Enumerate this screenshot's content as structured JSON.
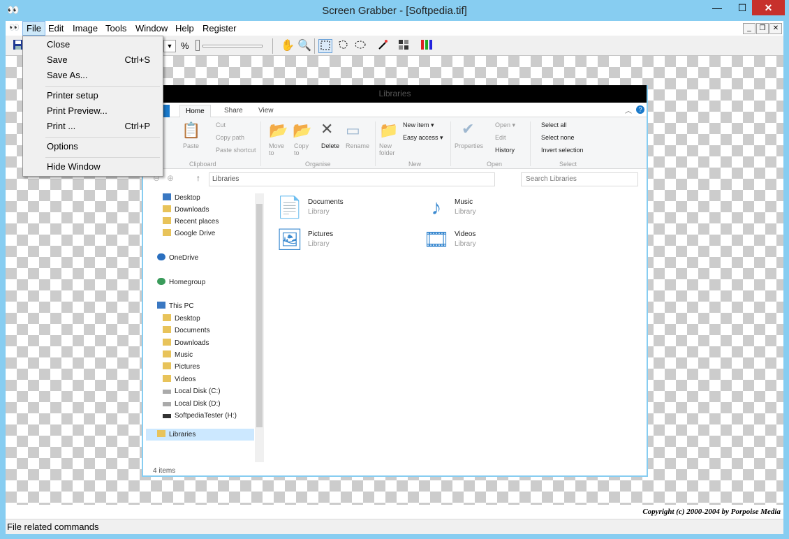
{
  "window": {
    "title": "Screen Grabber - [Softpedia.tif]",
    "minimize": "—",
    "maximize": "☐",
    "close": "✕"
  },
  "menubar": {
    "items": [
      {
        "label": "File"
      },
      {
        "label": "Edit"
      },
      {
        "label": "Image"
      },
      {
        "label": "Tools"
      },
      {
        "label": "Window"
      },
      {
        "label": "Help"
      },
      {
        "label": "Register"
      }
    ]
  },
  "toolbar": {
    "zoom_unit": "%"
  },
  "file_menu": {
    "items": [
      {
        "label": "Close",
        "shortcut": ""
      },
      {
        "label": "Save",
        "shortcut": "Ctrl+S"
      },
      {
        "label": "Save As...",
        "shortcut": ""
      },
      {
        "label": "Printer setup",
        "shortcut": ""
      },
      {
        "label": "Print Preview...",
        "shortcut": ""
      },
      {
        "label": "Print ...",
        "shortcut": "Ctrl+P"
      },
      {
        "label": "Options",
        "shortcut": ""
      },
      {
        "label": "Hide Window",
        "shortcut": ""
      }
    ]
  },
  "explorer": {
    "title": "Libraries",
    "tabs": [
      "Home",
      "Share",
      "View"
    ],
    "ribbon": {
      "clipboard": {
        "paste": "Paste",
        "cut": "Cut",
        "copy_path": "Copy path",
        "paste_shortcut": "Paste shortcut",
        "group": "Clipboard"
      },
      "organise": {
        "move_to": "Move to",
        "copy_to": "Copy to",
        "delete": "Delete",
        "rename": "Rename",
        "group": "Organise"
      },
      "new": {
        "new_folder": "New folder",
        "new_item": "New item ▾",
        "easy_access": "Easy access ▾",
        "group": "New"
      },
      "open": {
        "properties": "Properties",
        "open": "Open ▾",
        "edit": "Edit",
        "history": "History",
        "group": "Open"
      },
      "select": {
        "select_all": "Select all",
        "select_none": "Select none",
        "invert": "Invert selection",
        "group": "Select"
      }
    },
    "address": "Libraries",
    "search_placeholder": "Search Libraries",
    "nav": {
      "favorites": [
        "Desktop",
        "Downloads",
        "Recent places",
        "Google Drive"
      ],
      "onedrive": "OneDrive",
      "homegroup": "Homegroup",
      "thispc": "This PC",
      "pc_items": [
        "Desktop",
        "Documents",
        "Downloads",
        "Music",
        "Pictures",
        "Videos",
        "Local Disk (C:)",
        "Local Disk (D:)",
        "SoftpediaTester (H:)"
      ],
      "libraries": "Libraries"
    },
    "libraries": [
      {
        "name": "Documents",
        "type": "Library"
      },
      {
        "name": "Music",
        "type": "Library"
      },
      {
        "name": "Pictures",
        "type": "Library"
      },
      {
        "name": "Videos",
        "type": "Library"
      }
    ],
    "status": "4 items"
  },
  "copyright": "Copyright (c) 2000-2004 by Porpoise Media",
  "status": "File related commands"
}
